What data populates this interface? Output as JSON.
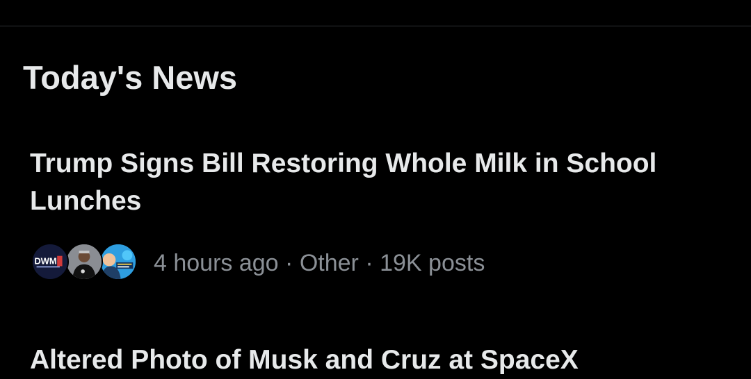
{
  "section": {
    "title": "Today's News"
  },
  "news": [
    {
      "headline": "Trump Signs Bill Restoring Whole Milk in School Lunches",
      "avatars": [
        {
          "name": "dwm-logo-avatar",
          "label": "DWM"
        },
        {
          "name": "man-portrait-avatar"
        },
        {
          "name": "news-logo-avatar"
        }
      ],
      "meta": {
        "time": "4 hours ago",
        "category": "Other",
        "posts": "19K posts",
        "separator": "·"
      }
    },
    {
      "headline": "Altered Photo of Musk and Cruz at SpaceX"
    }
  ],
  "colors": {
    "background": "#000000",
    "primary_text": "#e7e9ea",
    "secondary_text": "#8b9096",
    "divider": "#2f3336"
  }
}
